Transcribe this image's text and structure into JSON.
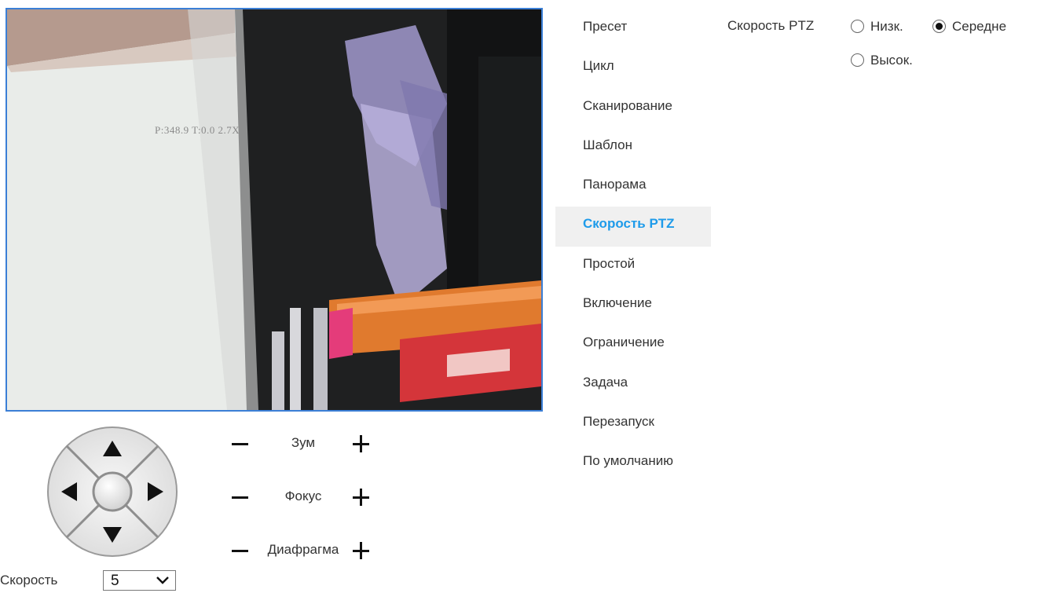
{
  "video": {
    "osd_text": "P:348.9 T:0.0 2.7X"
  },
  "ptz": {
    "zoom_label": "Зум",
    "focus_label": "Фокус",
    "iris_label": "Диафрагма",
    "speed_label": "Скорость",
    "speed_value": "5"
  },
  "menu": {
    "items": [
      {
        "label": "Пресет"
      },
      {
        "label": "Цикл"
      },
      {
        "label": "Сканирование"
      },
      {
        "label": "Шаблон"
      },
      {
        "label": "Панорама"
      },
      {
        "label": "Скорость PTZ",
        "active": true
      },
      {
        "label": "Простой"
      },
      {
        "label": "Включение"
      },
      {
        "label": "Ограничение"
      },
      {
        "label": "Задача"
      },
      {
        "label": "Перезапуск"
      },
      {
        "label": "По умолчанию"
      }
    ]
  },
  "settings": {
    "title": "Скорость PTZ",
    "options": [
      {
        "label": "Низк.",
        "selected": false
      },
      {
        "label": "Середне",
        "selected": true
      },
      {
        "label": "Высок.",
        "selected": false
      }
    ]
  },
  "colors": {
    "accent": "#1e9bea",
    "video_border": "#3b7fd6"
  }
}
